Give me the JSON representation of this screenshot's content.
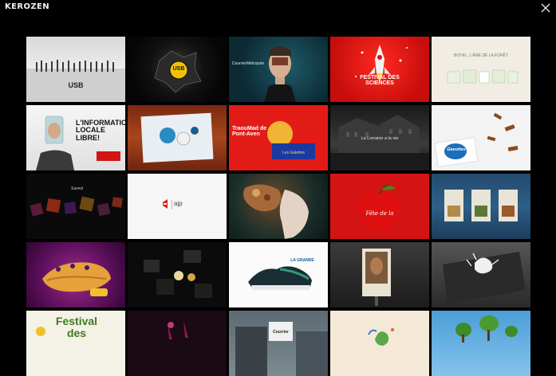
{
  "header": {
    "logo": "KEROZEN",
    "close_label": "close"
  },
  "tiles": [
    {
      "caption": ""
    },
    {
      "caption": "USB"
    },
    {
      "caption": "CourrierMétropole"
    },
    {
      "caption": "FESTIVAL DES SCIENCES"
    },
    {
      "caption": "BOYEL, L'ÂME DE LA FORÊT"
    },
    {
      "caption": "L'INFORMATION LOCALE LIBRE!"
    },
    {
      "caption": ""
    },
    {
      "caption": "TraouMad de Pont-Aven"
    },
    {
      "caption": "La Lorraine a la vie"
    },
    {
      "caption": "Gavottes"
    },
    {
      "caption": ""
    },
    {
      "caption": "ajp"
    },
    {
      "caption": ""
    },
    {
      "caption": ""
    },
    {
      "caption": ""
    },
    {
      "caption": ""
    },
    {
      "caption": ""
    },
    {
      "caption": ""
    },
    {
      "caption": ""
    },
    {
      "caption": ""
    },
    {
      "caption": "Festival des"
    },
    {
      "caption": ""
    },
    {
      "caption": ""
    },
    {
      "caption": ""
    },
    {
      "caption": ""
    }
  ]
}
